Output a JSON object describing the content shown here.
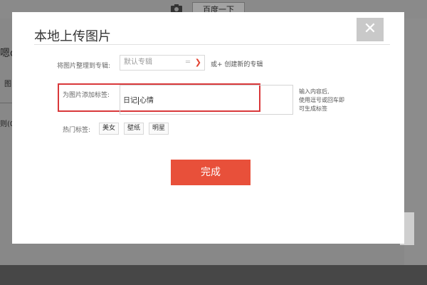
{
  "background": {
    "search_button": "百度一下",
    "left_text1": "嗯d",
    "left_text2": "图",
    "left_text3": "则(0"
  },
  "modal": {
    "title": "本地上传图片",
    "close_glyph": "✕",
    "album": {
      "label": "将图片整理到专辑:",
      "selected": "默认专辑",
      "create_link": "或+ 创建新的专辑"
    },
    "tags": {
      "label": "为图片添加标签:",
      "value_before_caret": "日记",
      "value_after_caret": "心情",
      "hint_lines": [
        "输入内容后,",
        "使用逗号或回车即",
        "可生成标签"
      ]
    },
    "hot_tags": {
      "label": "热门标签:",
      "items": [
        "美女",
        "壁纸",
        "明星"
      ]
    },
    "done_button": "完成"
  }
}
